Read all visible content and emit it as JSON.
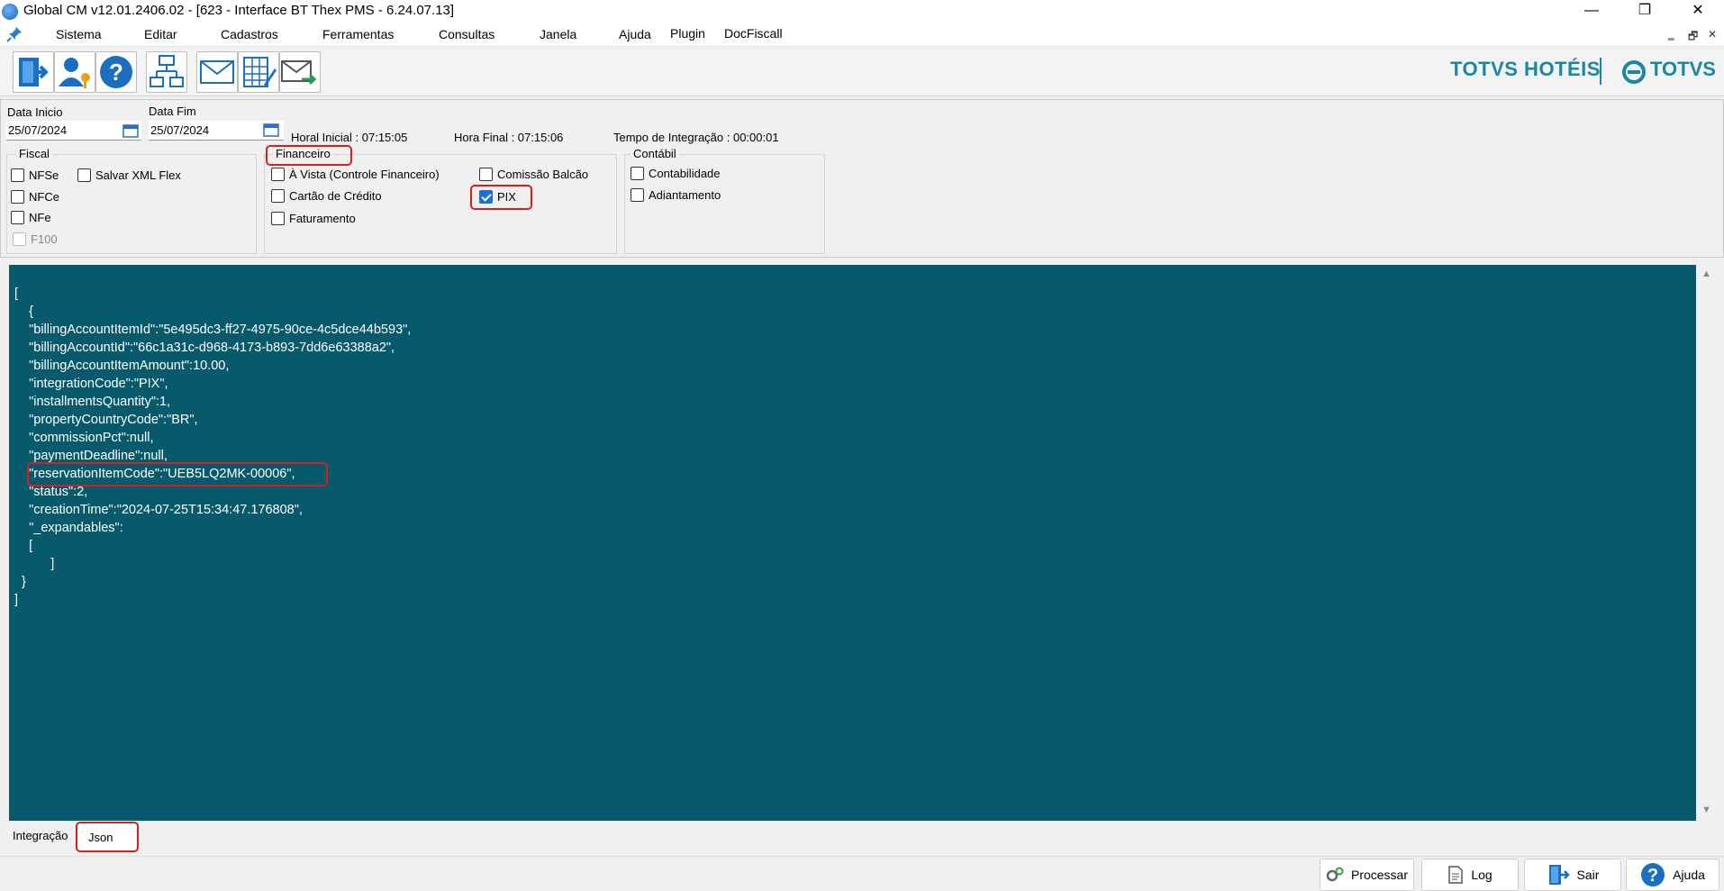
{
  "window": {
    "title": "Global CM v12.01.2406.02 - [623 - Interface BT Thex PMS - 6.24.07.13]",
    "minimize": "—",
    "restore": "❐",
    "close": "✕"
  },
  "menu": {
    "items": [
      "Sistema",
      "Editar",
      "Cadastros",
      "Ferramentas",
      "Consultas",
      "Janela",
      "Ajuda",
      "Plugin",
      "DocFiscall"
    ],
    "mdi_min": "‗",
    "mdi_restore": "🗗",
    "mdi_close": "✕"
  },
  "brand": {
    "hoteis": "TOTVS HOTÉIS",
    "totvs": "TOTVS",
    "color": "#1a88a4"
  },
  "filters": {
    "data_inicio_label": "Data Inicio",
    "data_inicio_value": "25/07/2024",
    "data_fim_label": "Data Fim",
    "data_fim_value": "25/07/2024",
    "hora_inicial": "Horal Inicial : 07:15:05",
    "hora_final": "Hora Final : 07:15:06",
    "tempo": "Tempo de Integração :  00:00:01"
  },
  "fiscal": {
    "legend": "Fiscal",
    "nfse": "NFSe",
    "nfce": "NFCe",
    "nfe": "NFe",
    "f100": "F100",
    "salvar_xml": "Salvar XML Flex"
  },
  "financeiro": {
    "legend": "Financeiro",
    "a_vista": "À Vista (Controle Financeiro)",
    "cartao": "Cartão de Crédito",
    "faturamento": "Faturamento",
    "comissao": "Comissão Balcão",
    "pix": "PIX"
  },
  "contabil": {
    "legend": "Contábil",
    "contabilidade": "Contabilidade",
    "adiantamento": "Adiantamento"
  },
  "json": {
    "lines": [
      "[",
      "    {",
      "    \"billingAccountItemId\":\"5e495dc3-ff27-4975-90ce-4c5dce44b593\",",
      "    \"billingAccountId\":\"66c1a31c-d968-4173-b893-7dd6e63388a2\",",
      "    \"billingAccountItemAmount\":10.00,",
      "    \"integrationCode\":\"PIX\",",
      "    \"installmentsQuantity\":1,",
      "    \"propertyCountryCode\":\"BR\",",
      "    \"commissionPct\":null,",
      "    \"paymentDeadline\":null,",
      "    \"reservationItemCode\":\"UEB5LQ2MK-00006\",",
      "    \"status\":2,",
      "    \"creationTime\":\"2024-07-25T15:34:47.176808\",",
      "    \"_expandables\":",
      "    [",
      "          ]",
      "  }",
      "]"
    ],
    "background": "#065a6b"
  },
  "tabs": {
    "integracao": "Integração",
    "json": "Json"
  },
  "buttons": {
    "processar": "Processar",
    "log": "Log",
    "sair": "Sair",
    "ajuda": "Ajuda"
  },
  "scroll": {
    "up": "▲",
    "down": "▼"
  }
}
